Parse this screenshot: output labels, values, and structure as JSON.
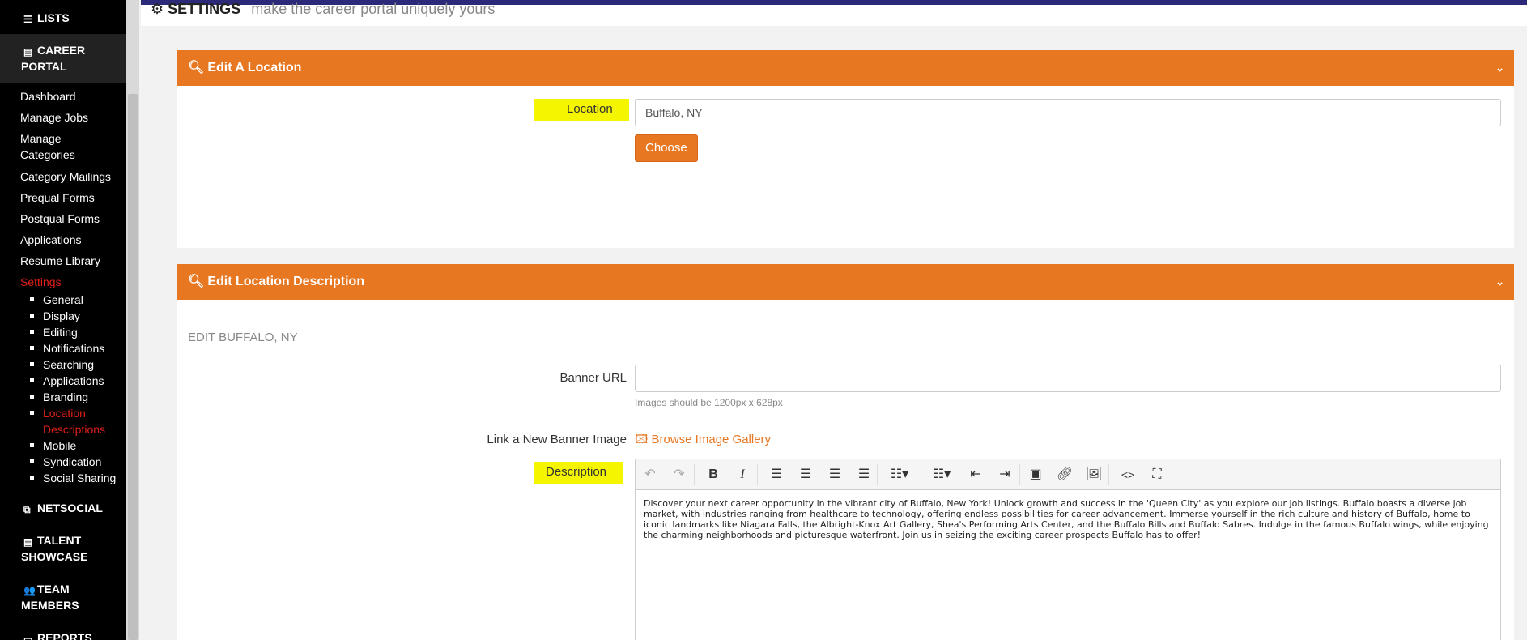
{
  "sidebar": {
    "lists_label": "LISTS",
    "career_portal_label": "CAREER PORTAL",
    "links": [
      "Dashboard",
      "Manage Jobs",
      "Manage Categories",
      "Category Mailings",
      "Prequal Forms",
      "Postqual Forms",
      "Applications",
      "Resume Library"
    ],
    "settings_label": "Settings",
    "settings_items": [
      "General",
      "Display",
      "Editing",
      "Notifications",
      "Searching",
      "Applications",
      "Branding",
      "Location Descriptions",
      "Mobile",
      "Syndication",
      "Social Sharing"
    ],
    "netsocial_label": "NETSOCIAL",
    "talent_showcase_label": "TALENT SHOWCASE",
    "team_members_label": "TEAM MEMBERS",
    "reports_label": "REPORTS"
  },
  "header": {
    "title": "SETTINGS",
    "subtitle": "make the career portal uniquely yours"
  },
  "edit_location": {
    "heading": "Edit A Location",
    "location_label": "Location",
    "location_value": "Buffalo, NY",
    "choose_label": "Choose"
  },
  "edit_description": {
    "heading": "Edit Location Description",
    "section_title": "EDIT BUFFALO, NY",
    "banner_url_label": "Banner URL",
    "banner_url_value": "",
    "banner_hint": "Images should be 1200px x 628px",
    "new_banner_label": "Link a New Banner Image",
    "browse_gallery_label": "Browse Image Gallery",
    "description_label": "Description",
    "description_text": "Discover your next career opportunity in the vibrant city of Buffalo, New York! Unlock growth and success in the 'Queen City' as you explore our job listings. Buffalo boasts a diverse job market, with industries ranging from healthcare to technology, offering endless possibilities for career advancement. Immerse yourself in the rich culture and history of Buffalo, home to iconic landmarks like Niagara Falls, the Albright-Knox Art Gallery, Shea's Performing Arts Center, and the Buffalo Bills and Buffalo Sabres. Indulge in the famous Buffalo wings, while enjoying the charming neighborhoods and picturesque waterfront. Join us in seizing the exciting career prospects Buffalo has to offer!"
  },
  "colors": {
    "accent": "#e87722",
    "topbar": "#2c2a78",
    "sidebar_bg": "#000000",
    "active_link": "#e0201b",
    "highlight": "#f5f500"
  }
}
